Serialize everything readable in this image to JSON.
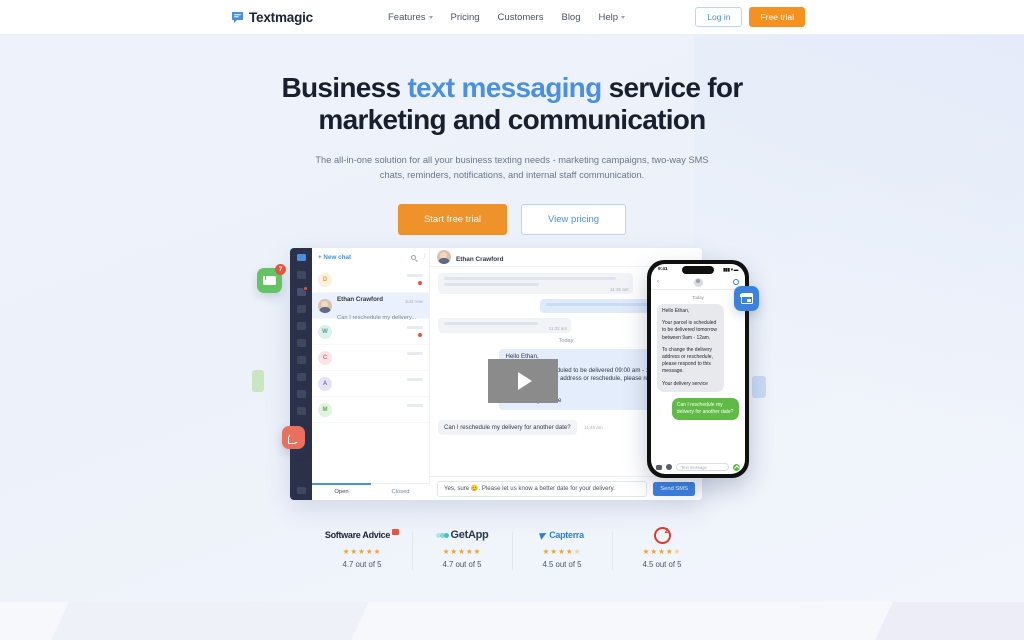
{
  "header": {
    "logo_text": "Textmagic",
    "nav": [
      {
        "label": "Features",
        "has_caret": true
      },
      {
        "label": "Pricing",
        "has_caret": false
      },
      {
        "label": "Customers",
        "has_caret": false
      },
      {
        "label": "Blog",
        "has_caret": false
      },
      {
        "label": "Help",
        "has_caret": true
      }
    ],
    "login_label": "Log in",
    "freetrial_label": "Free trial"
  },
  "hero": {
    "headline_part1": "Business ",
    "headline_accent": "text messaging",
    "headline_part2": " service for",
    "headline_line2": "marketing and communication",
    "subhead": "The all-in-one solution for all your business texting needs - marketing campaigns, two-way SMS chats, reminders, notifications, and internal staff communication.",
    "cta_primary": "Start free trial",
    "cta_secondary": "View pricing"
  },
  "app": {
    "new_chat_label": "+ New chat",
    "chat_rows": [
      {
        "initial": "D",
        "bg": "#fbf0da",
        "color": "#d6a43f",
        "unread": true
      },
      {
        "initial": "",
        "name": "Ethan Crawford",
        "message": "Can I reschedule my delivery...",
        "time": "Just now",
        "selected": true,
        "photo": true
      },
      {
        "initial": "W",
        "bg": "#ddf0ec",
        "color": "#4da094",
        "unread": true
      },
      {
        "initial": "C",
        "bg": "#fbe3e6",
        "color": "#d9697a",
        "unread": false
      },
      {
        "initial": "A",
        "bg": "#e7e3f7",
        "color": "#7c72c2",
        "unread": false
      },
      {
        "initial": "M",
        "bg": "#e2f3df",
        "color": "#68ab5e",
        "unread": false
      }
    ],
    "tab_open": "Open",
    "tab_closed": "Closed",
    "conversation": {
      "contact_name": "Ethan Crawford",
      "time_1": "11:35 am",
      "time_2": "11:32 am",
      "day_separator": "Today",
      "greeting": "Hello Ethan,",
      "body_line": "Your parcel is scheduled to be delivered 09:00 am - 12:00 am. To change the delivery address or reschedule, please respond to this message.",
      "signature": "Your delivery service",
      "incoming_message": "Can I reschedule my delivery for another date?",
      "incoming_time": "11:45 am",
      "composer_value": "Yes, sure 😊.  Please let us know a better date for your delivery.",
      "send_label": "Send SMS"
    },
    "notification_count": "7"
  },
  "phone": {
    "status_time": "9:41",
    "signal": "▮▮▮ ▾ ▬",
    "day": "Today",
    "greeting": "Hello Ethan,",
    "para1": "Your parcel is scheduled to be delivered tomorrow between 9am - 12am.",
    "para2": "To change the delivery address or reschedule, please respond to this message.",
    "signature": "Your delivery service",
    "reply": "Can I reschedule my delivery for another date?",
    "input_placeholder": "Text message"
  },
  "reviews": [
    {
      "name": "Software Advice",
      "suffix": ".",
      "logo_color": "#1d2330",
      "stars": 5,
      "half": false,
      "score": "4.7 out of 5"
    },
    {
      "name": "GetApp",
      "suffix": "",
      "logo_color": "#2d3a4a",
      "stars": 5,
      "half": false,
      "score": "4.7 out of 5"
    },
    {
      "name": "Capterra",
      "suffix": "",
      "logo_color": "#2f7fe0",
      "stars": 4,
      "half": true,
      "score": "4.5 out of 5"
    },
    {
      "name": "G2",
      "suffix": "",
      "logo_color": "#e03a2f",
      "stars": 4,
      "half": true,
      "score": "4.5 out of 5"
    }
  ],
  "colors": {
    "accent_blue": "#4a90e2",
    "accent_orange": "#f0922a",
    "dark_rail": "#2b3149",
    "star_gold": "#f3a32c",
    "green_badge": "#62c462",
    "red_badge": "#e8553f"
  }
}
